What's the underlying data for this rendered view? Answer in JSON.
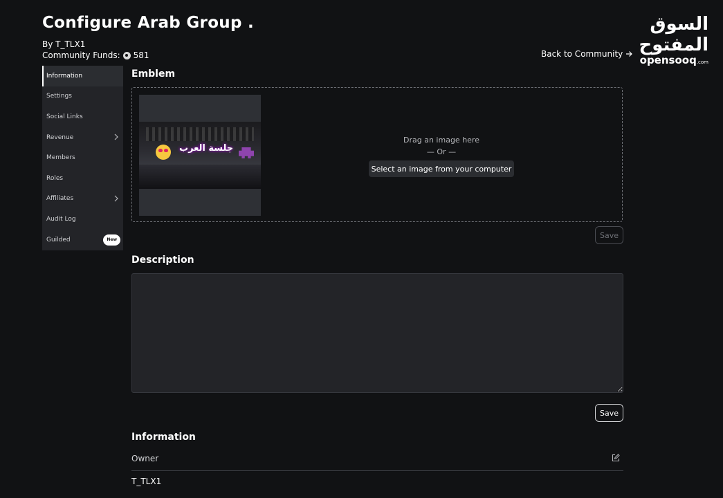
{
  "header": {
    "title": "Configure Arab Group .",
    "byline": "By T_TLX1",
    "funds_label": "Community Funds:",
    "funds_value": "581",
    "back_link": "Back to Community"
  },
  "logo": {
    "arabic": "السوق المفتوح",
    "english": "opensooq",
    "suffix": ".com"
  },
  "sidebar": {
    "items": [
      {
        "label": "Information",
        "active": true
      },
      {
        "label": "Settings"
      },
      {
        "label": "Social Links"
      },
      {
        "label": "Revenue",
        "has_submenu": true
      },
      {
        "label": "Members"
      },
      {
        "label": "Roles"
      },
      {
        "label": "Affiliates",
        "has_submenu": true
      },
      {
        "label": "Audit Log"
      },
      {
        "label": "Guilded",
        "badge": "New"
      }
    ]
  },
  "emblem": {
    "section_title": "Emblem",
    "image_text": "جلسة العرب",
    "drag_text": "Drag an image here",
    "or_text": "— Or —",
    "select_button": "Select an image from your computer",
    "save_label": "Save"
  },
  "description": {
    "section_title": "Description",
    "value": "",
    "save_label": "Save"
  },
  "information": {
    "section_title": "Information",
    "owner_label": "Owner",
    "owner_value": "T_TLX1"
  },
  "icons": {
    "funds": "coin-icon",
    "back": "arrow-right-icon",
    "submenu": "chevron-right-icon",
    "edit": "edit-icon"
  },
  "colors": {
    "background": "#111214",
    "sidebar": "#232428",
    "input": "#232428"
  }
}
